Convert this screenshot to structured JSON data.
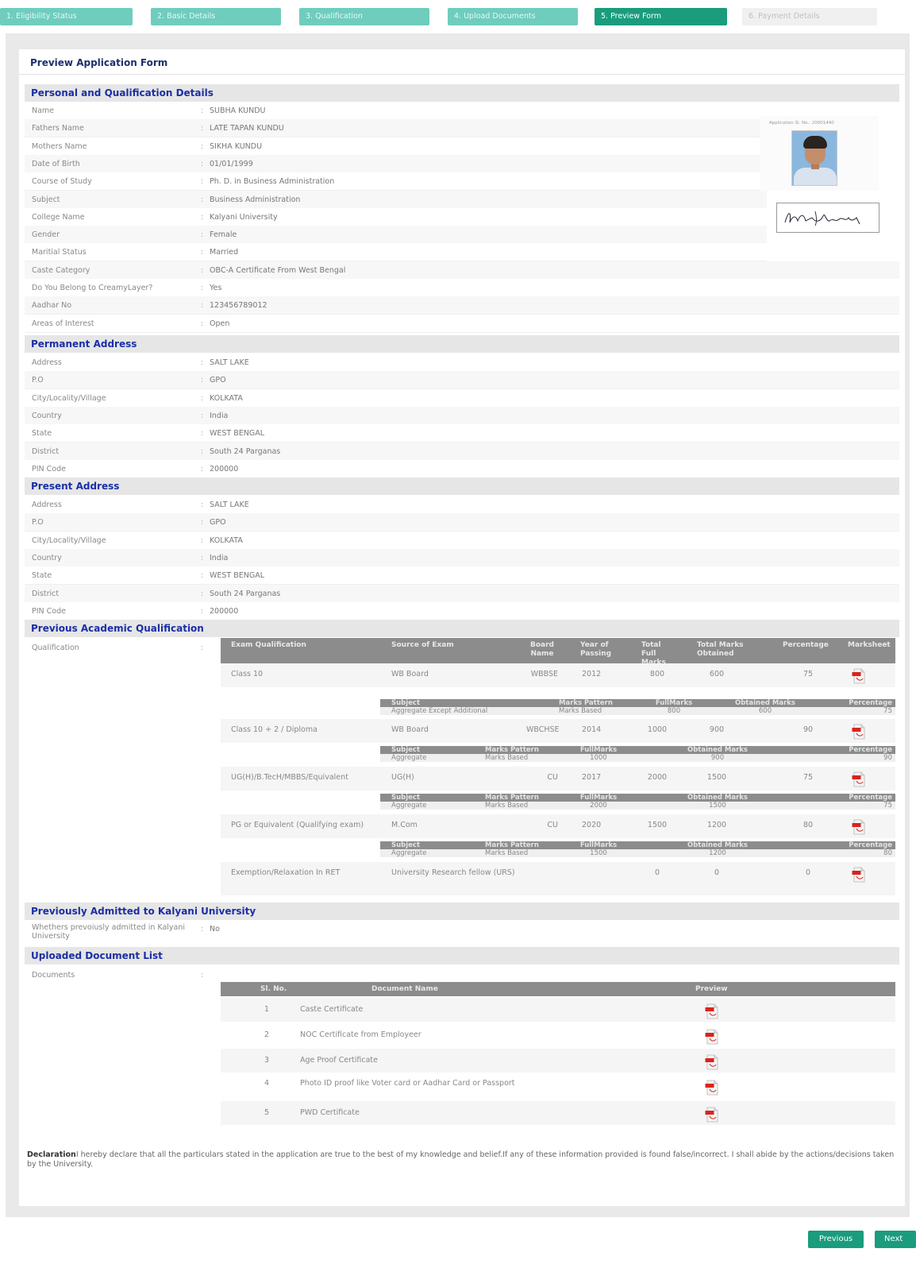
{
  "steps": [
    "1. Eligibility Status",
    "2. Basic Details",
    "3. Qualification",
    "4. Upload Documents",
    "5. Preview Form",
    "6. Payment Details"
  ],
  "preview_title": "Preview Application Form",
  "sections": {
    "personal": "Personal and Qualification Details",
    "permanent": "Permanent Address",
    "present": "Present Address",
    "academic": "Previous Academic Qualification",
    "admitted": "Previously Admitted to Kalyani University",
    "uploaded": "Uploaded Document List"
  },
  "application_no": "Application Sl. No.: 20001440",
  "personal": [
    {
      "label": "Name",
      "value": "SUBHA KUNDU"
    },
    {
      "label": "Fathers Name",
      "value": "LATE TAPAN KUNDU"
    },
    {
      "label": "Mothers Name",
      "value": "SIKHA KUNDU"
    },
    {
      "label": "Date of Birth",
      "value": "01/01/1999"
    },
    {
      "label": "Course of Study",
      "value": "Ph. D. in Business Administration"
    },
    {
      "label": "Subject",
      "value": "Business Administration"
    },
    {
      "label": "College Name",
      "value": "Kalyani University"
    },
    {
      "label": "Gender",
      "value": "Female"
    },
    {
      "label": "Maritial Status",
      "value": "Married"
    },
    {
      "label": "Caste Category",
      "value": "OBC-A Certificate From West Bengal"
    },
    {
      "label": "Do You Belong to CreamyLayer?",
      "value": "Yes"
    },
    {
      "label": "Aadhar No",
      "value": "123456789012"
    },
    {
      "label": "Areas of Interest",
      "value": "Open"
    }
  ],
  "permanent": [
    {
      "label": "Address",
      "value": "SALT LAKE"
    },
    {
      "label": "P.O",
      "value": "GPO"
    },
    {
      "label": "City/Locality/Village",
      "value": "KOLKATA"
    },
    {
      "label": "Country",
      "value": "India"
    },
    {
      "label": "State",
      "value": "WEST BENGAL"
    },
    {
      "label": "District",
      "value": "South 24 Parganas"
    },
    {
      "label": "PIN Code",
      "value": "200000"
    }
  ],
  "present": [
    {
      "label": "Address",
      "value": "SALT LAKE"
    },
    {
      "label": "P.O",
      "value": "GPO"
    },
    {
      "label": "City/Locality/Village",
      "value": "KOLKATA"
    },
    {
      "label": "Country",
      "value": "India"
    },
    {
      "label": "State",
      "value": "WEST BENGAL"
    },
    {
      "label": "District",
      "value": "South 24 Parganas"
    },
    {
      "label": "PIN Code",
      "value": "200000"
    }
  ],
  "qualification_label": "Qualification",
  "academic_headers": [
    "Exam Qualification",
    "Source of Exam",
    "Board Name",
    "Year of Passing",
    "Total Full Marks",
    "Total Marks Obtained",
    "Percentage",
    "Marksheet"
  ],
  "academic_rows": [
    {
      "exam": "Class 10",
      "source": "WB Board",
      "board": "WBBSE",
      "year": "2012",
      "full": "800",
      "obtained": "600",
      "pct": "75"
    },
    {
      "exam": "Class 10 + 2 / Diploma",
      "source": "WB Board",
      "board": "WBCHSE",
      "year": "2014",
      "full": "1000",
      "obtained": "900",
      "pct": "90"
    },
    {
      "exam": "UG(H)/B.TecH/MBBS/Equivalent",
      "source": "UG(H)",
      "board": "CU",
      "year": "2017",
      "full": "2000",
      "obtained": "1500",
      "pct": "75"
    },
    {
      "exam": "PG or Equivalent (Qualifying exam)",
      "source": "M.Com",
      "board": "CU",
      "year": "2020",
      "full": "1500",
      "obtained": "1200",
      "pct": "80"
    },
    {
      "exam": "Exemption/Relaxation In RET",
      "source": "University Research fellow (URS)",
      "board": "",
      "year": "",
      "full": "0",
      "obtained": "0",
      "pct": "0"
    }
  ],
  "sub_headers": [
    "Subject",
    "Marks Pattern",
    "FullMarks",
    "Obtained Marks",
    "Percentage"
  ],
  "sub_rows": [
    {
      "subject": "Aggregate Except Additional",
      "pattern": "Marks Based",
      "full": "800",
      "obtained": "600",
      "pct": "75"
    },
    {
      "subject": "Aggregate",
      "pattern": "Marks Based",
      "full": "1000",
      "obtained": "900",
      "pct": "90"
    },
    {
      "subject": "Aggregate",
      "pattern": "Marks Based",
      "full": "2000",
      "obtained": "1500",
      "pct": "75"
    },
    {
      "subject": "Aggregate",
      "pattern": "Marks Based",
      "full": "1500",
      "obtained": "1200",
      "pct": "80"
    }
  ],
  "admitted": {
    "label": "Whethers prevoiusly admitted in Kalyani University",
    "value": "No"
  },
  "documents_label": "Documents",
  "doc_headers": [
    "Sl. No.",
    "Document Name",
    "Preview"
  ],
  "documents": [
    {
      "no": "1",
      "name": "Caste Certificate"
    },
    {
      "no": "2",
      "name": "NOC Certificate from Employeer"
    },
    {
      "no": "3",
      "name": "Age Proof Certificate"
    },
    {
      "no": "4",
      "name": "Photo ID proof like Voter card or Aadhar Card or Passport"
    },
    {
      "no": "5",
      "name": "PWD Certificate"
    }
  ],
  "declaration_bold": "Declaration",
  "declaration_text": "I hereby declare that all the particulars stated in the application are true to the best of my knowledge and belief.If any of these information provided is found false/incorrect. I shall abide by the actions/decisions taken by the University.",
  "buttons": {
    "previous": "Previous",
    "next": "Next"
  },
  "colors": {
    "step": "#6fcdbd",
    "step_active": "#1a9c7d",
    "section_title": "#1a2fa6",
    "table_head": "#8c8c8c"
  }
}
